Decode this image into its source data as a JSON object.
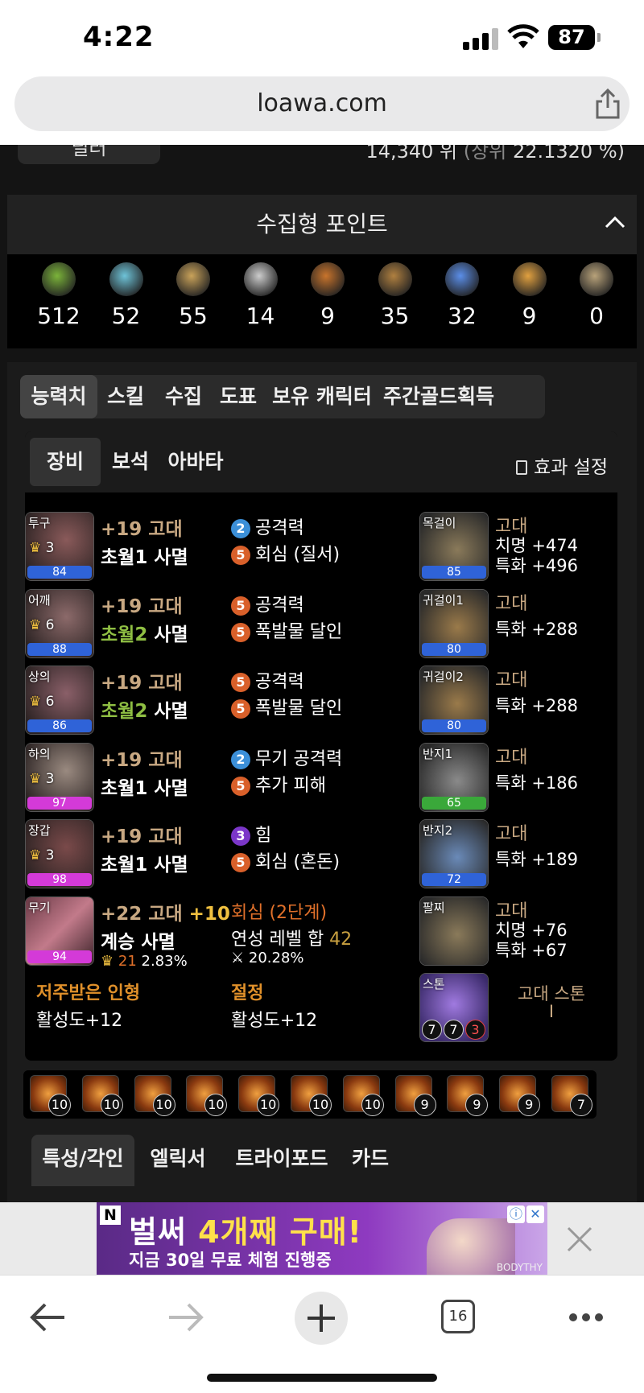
{
  "status": {
    "time": "4:22",
    "battery": "87"
  },
  "browser": {
    "url": "loawa.com",
    "tab_count": "16"
  },
  "top": {
    "pill": "딜러",
    "rank_text": "14,340 위",
    "rank_paren": "(상위",
    "rank_pct": "22.1320 %)"
  },
  "collect": {
    "title": "수집형 포인트",
    "items": [
      {
        "icon": "seed-icon",
        "value": "512"
      },
      {
        "icon": "island-orb-icon",
        "value": "52"
      },
      {
        "icon": "map-scroll-icon",
        "value": "55"
      },
      {
        "icon": "giant-heart-icon",
        "value": "14"
      },
      {
        "icon": "art-mask-icon",
        "value": "9"
      },
      {
        "icon": "telescope-icon",
        "value": "35"
      },
      {
        "icon": "world-tree-leaf-icon",
        "value": "32"
      },
      {
        "icon": "star-compass-icon",
        "value": "9"
      },
      {
        "icon": "token-icon",
        "value": "0"
      }
    ]
  },
  "tabs_main": [
    "능력치",
    "스킬",
    "수집",
    "도표",
    "보유 캐릭터",
    "주간골드획득"
  ],
  "tabs_sub": [
    "장비",
    "보석",
    "아바타"
  ],
  "effect_setting": "효과 설정",
  "equipment": [
    {
      "slot": "투구",
      "level": "3",
      "quality": "84",
      "bar": "#2f63d8",
      "grade": "+19 고대",
      "set_a": "초월1",
      "set_b": "사멸",
      "green": false,
      "engr": [
        {
          "n": "2",
          "c": "blue",
          "t": "공격력"
        },
        {
          "n": "5",
          "c": "orange",
          "t": "회심 (질서)"
        }
      ]
    },
    {
      "slot": "어깨",
      "level": "6",
      "quality": "88",
      "bar": "#2f63d8",
      "grade": "+19 고대",
      "set_a": "초월2",
      "set_b": "사멸",
      "green": true,
      "engr": [
        {
          "n": "5",
          "c": "orange",
          "t": "공격력"
        },
        {
          "n": "5",
          "c": "orange",
          "t": "폭발물 달인"
        }
      ]
    },
    {
      "slot": "상의",
      "level": "6",
      "quality": "86",
      "bar": "#2f63d8",
      "grade": "+19 고대",
      "set_a": "초월2",
      "set_b": "사멸",
      "green": true,
      "engr": [
        {
          "n": "5",
          "c": "orange",
          "t": "공격력"
        },
        {
          "n": "5",
          "c": "orange",
          "t": "폭발물 달인"
        }
      ]
    },
    {
      "slot": "하의",
      "level": "3",
      "quality": "97",
      "bar": "#d43ad8",
      "grade": "+19 고대",
      "set_a": "초월1",
      "set_b": "사멸",
      "green": false,
      "engr": [
        {
          "n": "2",
          "c": "blue",
          "t": "무기 공격력"
        },
        {
          "n": "5",
          "c": "orange",
          "t": "추가 피해"
        }
      ]
    },
    {
      "slot": "장갑",
      "level": "3",
      "quality": "98",
      "bar": "#d43ad8",
      "grade": "+19 고대",
      "set_a": "초월1",
      "set_b": "사멸",
      "green": false,
      "engr": [
        {
          "n": "3",
          "c": "purple",
          "t": "힘"
        },
        {
          "n": "5",
          "c": "orange",
          "t": "회심 (혼돈)"
        }
      ]
    }
  ],
  "weapon": {
    "slot": "무기",
    "quality": "94",
    "grade": "+22 고대",
    "plus": "+10",
    "set_a": "계승",
    "set_b": "사멸",
    "transcend": "21",
    "transcend_pct": "2.83%",
    "elixir": "회심 (2단계)",
    "elixir_sum_label": "연성 레벨 합",
    "elixir_sum": "42",
    "elixir_pct": "20.28%"
  },
  "footer": {
    "left_title": "저주받은 인형",
    "left_val": "활성도+12",
    "right_title": "절정",
    "right_val": "활성도+12"
  },
  "accessories": [
    {
      "slot": "목걸이",
      "quality": "85",
      "bar": "#2f63d8",
      "grade": "고대",
      "stats": [
        "치명 +474",
        "특화 +496"
      ]
    },
    {
      "slot": "귀걸이1",
      "quality": "80",
      "bar": "#2f63d8",
      "grade": "고대",
      "stats": [
        "특화 +288"
      ]
    },
    {
      "slot": "귀걸이2",
      "quality": "80",
      "bar": "#2f63d8",
      "grade": "고대",
      "stats": [
        "특화 +288"
      ]
    },
    {
      "slot": "반지1",
      "quality": "65",
      "bar": "#3aa83a",
      "grade": "고대",
      "stats": [
        "특화 +186"
      ]
    },
    {
      "slot": "반지2",
      "quality": "72",
      "bar": "#2f63d8",
      "grade": "고대",
      "stats": [
        "특화 +189"
      ]
    },
    {
      "slot": "팔찌",
      "quality": "",
      "bar": "",
      "grade": "고대",
      "stats": [
        "치명 +76",
        "특화 +67"
      ]
    }
  ],
  "stone": {
    "slot": "스톤",
    "name": "고대 스톤",
    "sub": "I",
    "nums": [
      "7",
      "7",
      "3"
    ]
  },
  "gems": [
    "10",
    "10",
    "10",
    "10",
    "10",
    "10",
    "10",
    "9",
    "9",
    "9",
    "7"
  ],
  "tabs_bottom": [
    "특성/각인",
    "엘릭서",
    "트라이포드",
    "카드"
  ],
  "ad": {
    "line1a": "벌써",
    "line1b": "4개째 구매!",
    "line2": "지금 30일 무료 체험 진행중",
    "brand": "BODYTHY"
  }
}
